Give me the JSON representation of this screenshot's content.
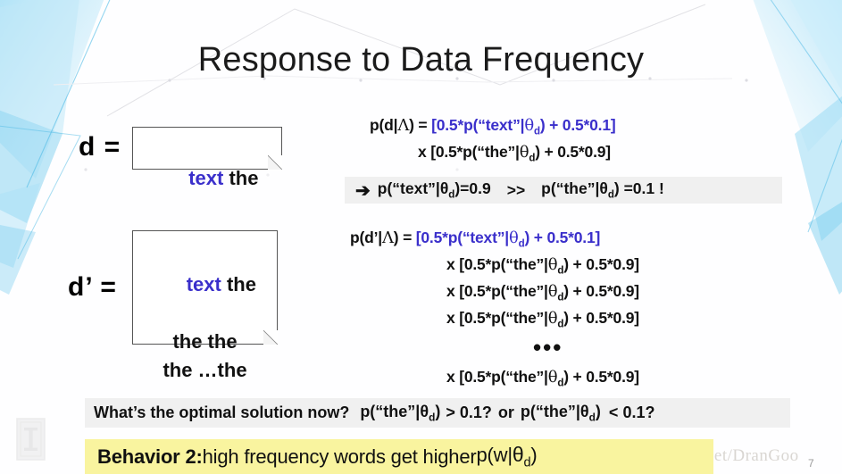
{
  "slide": {
    "title": "Response to Data Frequency",
    "page_number": "7",
    "watermark": "https://blog.csdn.net/DranGoo",
    "logo_icon": "pillar-logo-icon",
    "colors": {
      "blue": "#3a2fcb",
      "red": "#e01b1b",
      "black": "#111111",
      "band_gray": "#f0f0f0",
      "band_yellow": "#f9f49f",
      "deco_blue": "#8ed2f0"
    }
  },
  "documents": [
    {
      "label": "d =",
      "lines": [
        [
          {
            "t": "text",
            "c": "blue"
          },
          {
            "t": " the",
            "c": "black"
          }
        ]
      ]
    },
    {
      "label": "d’ =",
      "lines": [
        [
          {
            "t": "text",
            "c": "blue"
          },
          {
            "t": " the",
            "c": "black"
          }
        ],
        [
          {
            "t": "the the",
            "c": "black"
          }
        ],
        [
          {
            "t": "the …the",
            "c": "black"
          }
        ]
      ]
    }
  ],
  "equation_block_1": {
    "lines": [
      [
        {
          "t": "p(d|Λ) = ",
          "c": "black"
        },
        {
          "t": "[0.5*p(“text”|θ",
          "c": "blue",
          "sub_after": "d"
        },
        {
          "t": ") + 0.5*0.1]",
          "c": "blue"
        }
      ],
      [
        {
          "t": "x [0.5*p(“the”|θ",
          "c": "black",
          "sub_after": "d"
        },
        {
          "t": ") + 0.5*0.9]",
          "c": "black"
        }
      ]
    ],
    "line1_full": "p(d|Λ) = [0.5*p(“text”|θd) + 0.5*0.1]",
    "line2_full": "x [0.5*p(“the”|θd) + 0.5*0.9]"
  },
  "highlight_banner": {
    "arrow": "➔",
    "left_expr": "p(“text”|θd)=0.9",
    "comparator": ">>",
    "right_expr": "p(“the”|θd) =0.1 !"
  },
  "equation_block_2": {
    "line1_prefix": "p(d’|Λ) = ",
    "line1_blue": "[0.5*p(“text”|θd) + 0.5*0.1]",
    "repeat_line": "x [0.5*p(“the”|θd) + 0.5*0.9]",
    "repeat_count": 3,
    "ellipsis": "•••",
    "final_line": "x [0.5*p(“the”|θd) + 0.5*0.9]"
  },
  "question_banner": {
    "prompt": "What’s the optimal solution now?",
    "option_a_expr": "p(“the”|θd)",
    "option_a_comparator": ">",
    "option_a_value": "0.1?",
    "conjunction": "or",
    "option_b_expr": "p(“the”|θd)",
    "option_b_comparator": "<",
    "option_b_value": "0.1?"
  },
  "behavior_banner": {
    "label": "Behavior 2:",
    "text": " high frequency words get higher ",
    "expr": "p(w|θd)"
  }
}
